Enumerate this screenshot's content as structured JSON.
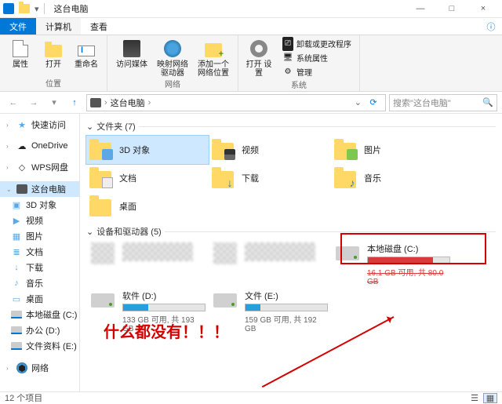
{
  "window": {
    "title": "这台电脑",
    "controls": {
      "min": "—",
      "max": "□",
      "close": "×"
    }
  },
  "ribbon": {
    "tabs": {
      "file": "文件",
      "computer": "计算机",
      "view": "查看"
    },
    "help": "?",
    "btns": {
      "properties": "属性",
      "open": "打开",
      "rename": "重命名",
      "media": "访问媒体",
      "mapdrive": "映射网络\n驱动器",
      "addnet": "添加一个\n网络位置",
      "opensettings": "打开\n设置"
    },
    "sysrow": {
      "uninstall": "卸载或更改程序",
      "sysprops": "系统属性",
      "manage": "管理"
    },
    "groups": {
      "location": "位置",
      "network": "网络",
      "system": "系统"
    }
  },
  "address": {
    "crumb": "这台电脑",
    "search_ph": "搜索\"这台电脑\""
  },
  "sidebar": {
    "items": [
      {
        "label": "快速访问",
        "icon": "star"
      },
      {
        "label": "OneDrive",
        "icon": "onedrive"
      },
      {
        "label": "WPS网盘",
        "icon": "wps"
      },
      {
        "label": "这台电脑",
        "icon": "pc",
        "selected": true
      },
      {
        "label": "3D 对象",
        "icon": "3d"
      },
      {
        "label": "视频",
        "icon": "vid"
      },
      {
        "label": "图片",
        "icon": "pic"
      },
      {
        "label": "文档",
        "icon": "doc"
      },
      {
        "label": "下载",
        "icon": "dl"
      },
      {
        "label": "音乐",
        "icon": "mus"
      },
      {
        "label": "桌面",
        "icon": "desk"
      },
      {
        "label": "本地磁盘 (C:)",
        "icon": "drv"
      },
      {
        "label": "办公 (D:)",
        "icon": "drv"
      },
      {
        "label": "文件资料 (E:)",
        "icon": "drv"
      },
      {
        "label": "网络",
        "icon": "net"
      }
    ]
  },
  "content": {
    "folders_header": "文件夹 (7)",
    "folders": [
      {
        "label": "3D 对象",
        "ov": "3d",
        "selected": true
      },
      {
        "label": "视频",
        "ov": "vid"
      },
      {
        "label": "图片",
        "ov": "pic"
      },
      {
        "label": "文档",
        "ov": "doc"
      },
      {
        "label": "下载",
        "ov": "dl",
        "glyph": "↓"
      },
      {
        "label": "音乐",
        "ov": "mus",
        "glyph": "♪"
      },
      {
        "label": "桌面",
        "ov": ""
      }
    ],
    "drives_header": "设备和驱动器 (5)",
    "drives_pix": [
      "",
      ""
    ],
    "drive_c": {
      "name": "本地磁盘 (C:)",
      "sub": "16.1 GB 可用, 共 80.0 GB",
      "fill": 80
    },
    "drive_d": {
      "name": "软件 (D:)",
      "sub": "133 GB 可用, 共 193 GB",
      "fill": 31
    },
    "drive_e": {
      "name": "文件 (E:)",
      "sub": "159 GB 可用, 共 192 GB",
      "fill": 18
    }
  },
  "annotation": "什么都没有！！！",
  "status": {
    "count": "12 个项目"
  }
}
